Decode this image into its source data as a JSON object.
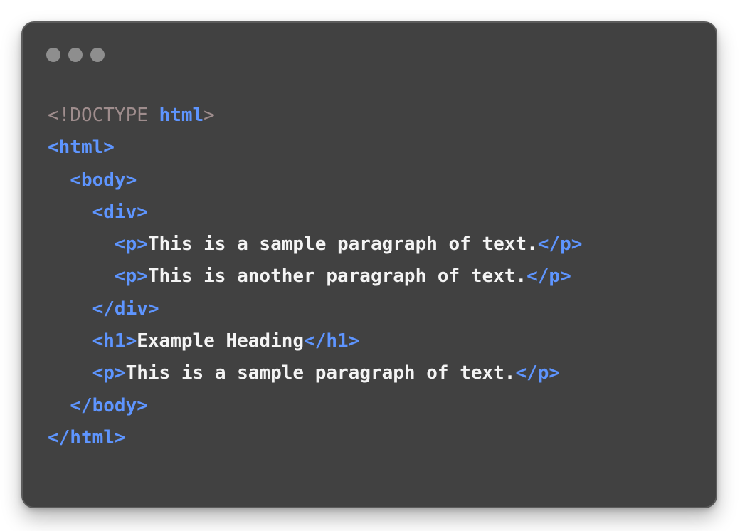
{
  "window": {
    "controls": [
      "window-dot-1",
      "window-dot-2",
      "window-dot-3"
    ]
  },
  "colors": {
    "background": "#414141",
    "tag": "#5e95ff",
    "doctype": "#9f8d8d",
    "text": "#f4f4f4",
    "dot": "#8e8e8e"
  },
  "code": {
    "lines": [
      [
        {
          "t": "doctype",
          "v": "<!DOCTYPE "
        },
        {
          "t": "tag",
          "v": "html"
        },
        {
          "t": "doctype",
          "v": ">"
        }
      ],
      [
        {
          "t": "tag",
          "v": "<html>"
        }
      ],
      [
        {
          "t": "ws",
          "v": "  "
        },
        {
          "t": "tag",
          "v": "<body>"
        }
      ],
      [
        {
          "t": "ws",
          "v": "    "
        },
        {
          "t": "tag",
          "v": "<div>"
        }
      ],
      [
        {
          "t": "ws",
          "v": "      "
        },
        {
          "t": "tag",
          "v": "<p>"
        },
        {
          "t": "text",
          "v": "This is a sample paragraph of text."
        },
        {
          "t": "tag",
          "v": "</p>"
        }
      ],
      [
        {
          "t": "ws",
          "v": "      "
        },
        {
          "t": "tag",
          "v": "<p>"
        },
        {
          "t": "text",
          "v": "This is another paragraph of text."
        },
        {
          "t": "tag",
          "v": "</p>"
        }
      ],
      [
        {
          "t": "ws",
          "v": "    "
        },
        {
          "t": "tag",
          "v": "</div>"
        }
      ],
      [
        {
          "t": "ws",
          "v": "    "
        },
        {
          "t": "tag",
          "v": "<h1>"
        },
        {
          "t": "text",
          "v": "Example Heading"
        },
        {
          "t": "tag",
          "v": "</h1>"
        }
      ],
      [
        {
          "t": "ws",
          "v": "    "
        },
        {
          "t": "tag",
          "v": "<p>"
        },
        {
          "t": "text",
          "v": "This is a sample paragraph of text."
        },
        {
          "t": "tag",
          "v": "</p>"
        }
      ],
      [
        {
          "t": "ws",
          "v": "  "
        },
        {
          "t": "tag",
          "v": "</body>"
        }
      ],
      [
        {
          "t": "tag",
          "v": "</html>"
        }
      ]
    ]
  }
}
